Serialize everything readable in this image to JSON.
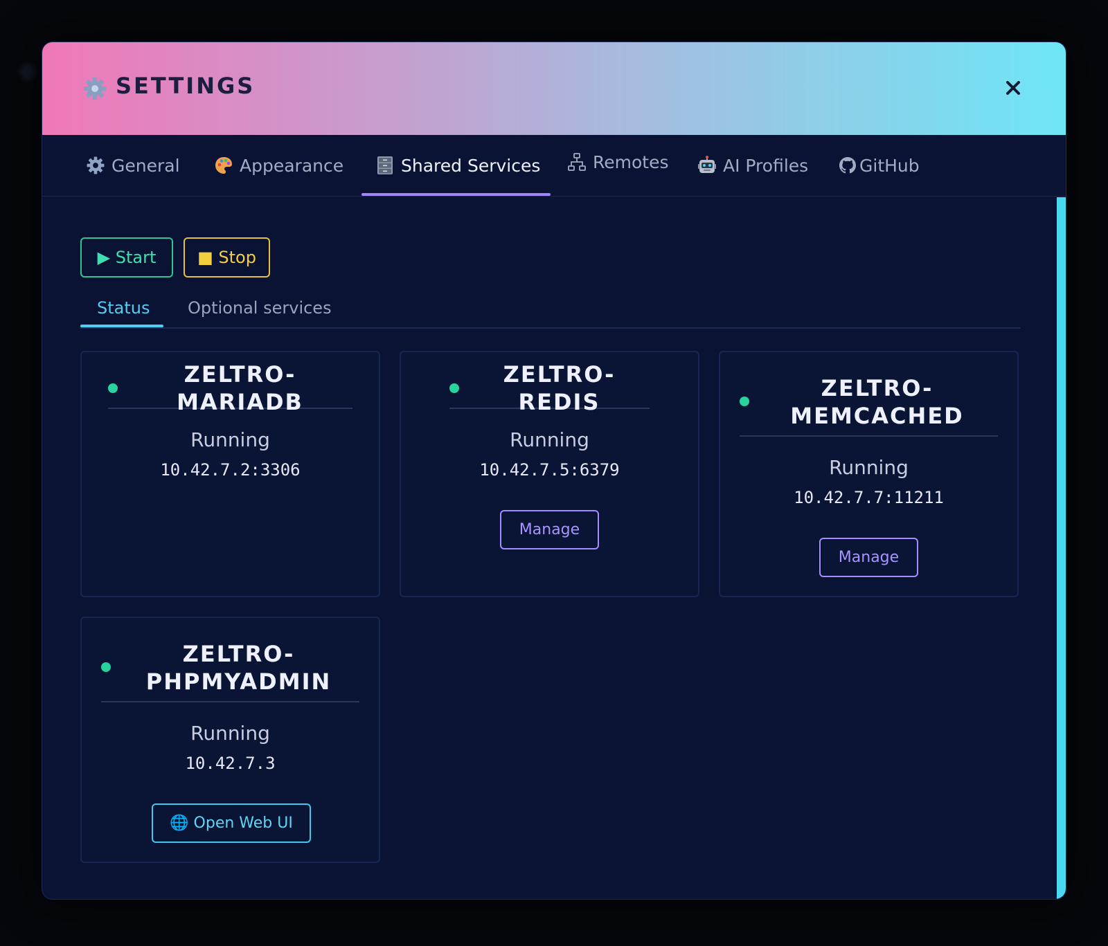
{
  "dialog": {
    "title": "SETTINGS",
    "header_icon": "gear-icon",
    "close_label": "✕"
  },
  "tabs": [
    {
      "label": "General",
      "icon": "gear-icon",
      "active": false
    },
    {
      "label": "Appearance",
      "icon": "palette-icon",
      "active": false
    },
    {
      "label": "Shared Services",
      "icon": "file-cabinet-icon",
      "active": true
    },
    {
      "label": "Remotes",
      "icon": "network-icon",
      "active": false
    },
    {
      "label": "AI Profiles",
      "icon": "robot-icon",
      "active": false
    },
    {
      "label": "GitHub",
      "icon": "github-icon",
      "active": false
    }
  ],
  "actions": {
    "start_label": "▶ Start",
    "stop_label": "■ Stop"
  },
  "subtabs": {
    "status": "Status",
    "optional": "Optional services",
    "active": "Status"
  },
  "services": [
    {
      "name": "ZELTRO-MARIADB",
      "status": "Running",
      "address": "10.42.7.2:3306",
      "button": ""
    },
    {
      "name": "ZELTRO-REDIS",
      "status": "Running",
      "address": "10.42.7.5:6379",
      "button": "Manage"
    },
    {
      "name": "ZELTRO-\nMEMCACHED",
      "status": "Running",
      "address": "10.42.7.7:11211",
      "button": "Manage"
    },
    {
      "name": "ZELTRO-\nPHPMYADMIN",
      "status": "Running",
      "address": "10.42.7.3",
      "button": "🌐 Open Web UI"
    }
  ],
  "colors": {
    "accent_purple": "#9f86ff",
    "accent_cyan": "#4fcff0",
    "running_green": "#28d49b",
    "start_green": "#2dc49a",
    "stop_yellow": "#e6c13a",
    "background": "#0a1333"
  }
}
